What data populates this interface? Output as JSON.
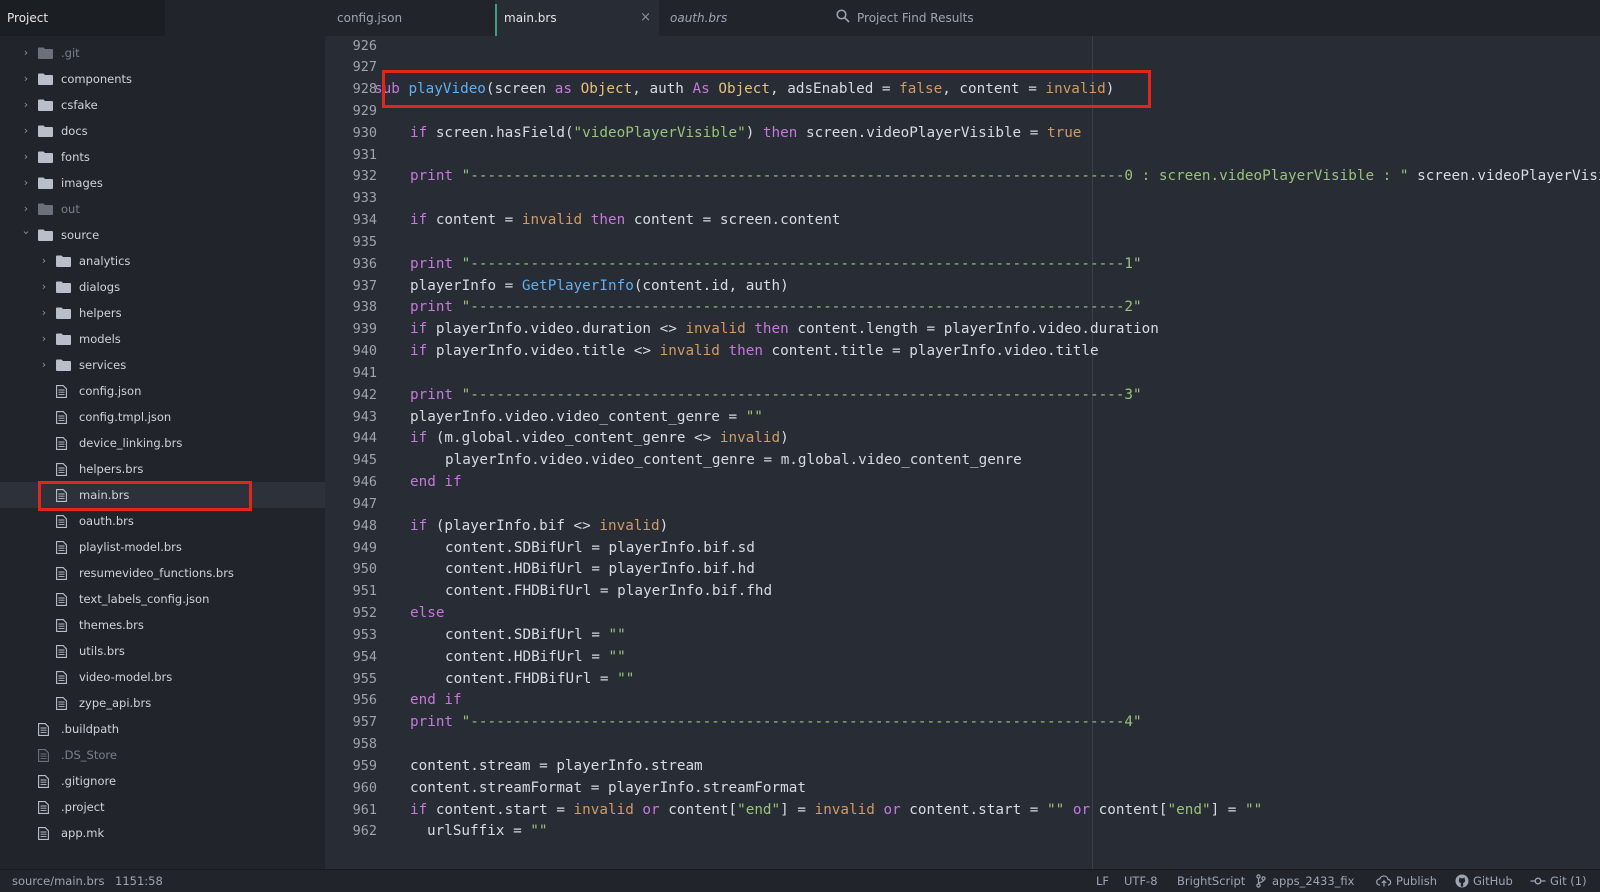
{
  "sidebar": {
    "title": "Project",
    "items": [
      {
        "label": ".git",
        "kind": "folder",
        "depth": 0,
        "expanded": false,
        "dim": true
      },
      {
        "label": "components",
        "kind": "folder",
        "depth": 0,
        "expanded": false
      },
      {
        "label": "csfake",
        "kind": "folder",
        "depth": 0,
        "expanded": false
      },
      {
        "label": "docs",
        "kind": "folder",
        "depth": 0,
        "expanded": false
      },
      {
        "label": "fonts",
        "kind": "folder",
        "depth": 0,
        "expanded": false
      },
      {
        "label": "images",
        "kind": "folder",
        "depth": 0,
        "expanded": false
      },
      {
        "label": "out",
        "kind": "folder",
        "depth": 0,
        "expanded": false,
        "dim": true
      },
      {
        "label": "source",
        "kind": "folder",
        "depth": 0,
        "expanded": true
      },
      {
        "label": "analytics",
        "kind": "folder",
        "depth": 1,
        "expanded": false
      },
      {
        "label": "dialogs",
        "kind": "folder",
        "depth": 1,
        "expanded": false
      },
      {
        "label": "helpers",
        "kind": "folder",
        "depth": 1,
        "expanded": false
      },
      {
        "label": "models",
        "kind": "folder",
        "depth": 1,
        "expanded": false
      },
      {
        "label": "services",
        "kind": "folder",
        "depth": 1,
        "expanded": false
      },
      {
        "label": "config.json",
        "kind": "file",
        "depth": 1
      },
      {
        "label": "config.tmpl.json",
        "kind": "file",
        "depth": 1
      },
      {
        "label": "device_linking.brs",
        "kind": "file",
        "depth": 1
      },
      {
        "label": "helpers.brs",
        "kind": "file",
        "depth": 1
      },
      {
        "label": "main.brs",
        "kind": "file",
        "depth": 1,
        "selected": true
      },
      {
        "label": "oauth.brs",
        "kind": "file",
        "depth": 1
      },
      {
        "label": "playlist-model.brs",
        "kind": "file",
        "depth": 1
      },
      {
        "label": "resumevideo_functions.brs",
        "kind": "file",
        "depth": 1
      },
      {
        "label": "text_labels_config.json",
        "kind": "file",
        "depth": 1
      },
      {
        "label": "themes.brs",
        "kind": "file",
        "depth": 1
      },
      {
        "label": "utils.brs",
        "kind": "file",
        "depth": 1
      },
      {
        "label": "video-model.brs",
        "kind": "file",
        "depth": 1
      },
      {
        "label": "zype_api.brs",
        "kind": "file",
        "depth": 1
      },
      {
        "label": ".buildpath",
        "kind": "file",
        "depth": 0
      },
      {
        "label": ".DS_Store",
        "kind": "file",
        "depth": 0,
        "dim": true
      },
      {
        "label": ".gitignore",
        "kind": "file",
        "depth": 0
      },
      {
        "label": ".project",
        "kind": "file",
        "depth": 0
      },
      {
        "label": "app.mk",
        "kind": "file",
        "depth": 0
      }
    ]
  },
  "tabs": [
    {
      "label": "config.json",
      "active": false,
      "italic": false
    },
    {
      "label": "main.brs",
      "active": true,
      "italic": false,
      "close": "×"
    },
    {
      "label": "oauth.brs",
      "active": false,
      "italic": true
    },
    {
      "label": "Project Find Results",
      "active": false,
      "italic": false,
      "icon": "search-icon"
    }
  ],
  "editor": {
    "lines": [
      {
        "n": "926",
        "indent": 0,
        "segments": []
      },
      {
        "n": "927",
        "indent": 0,
        "segments": []
      },
      {
        "n": "928",
        "indent": 0,
        "segments": [
          [
            "kw",
            "sub"
          ],
          [
            "p",
            " "
          ],
          [
            "fn",
            "playVideo"
          ],
          [
            "p",
            "(screen "
          ],
          [
            "kw",
            "as"
          ],
          [
            "p",
            " "
          ],
          [
            "kw2",
            "Object"
          ],
          [
            "p",
            ", auth "
          ],
          [
            "kw",
            "As"
          ],
          [
            "p",
            " "
          ],
          [
            "kw2",
            "Object"
          ],
          [
            "p",
            ", adsEnabled = "
          ],
          [
            "bool",
            "false"
          ],
          [
            "p",
            ", content = "
          ],
          [
            "bool",
            "invalid"
          ],
          [
            "p",
            ")"
          ]
        ]
      },
      {
        "n": "929",
        "indent": 0,
        "segments": []
      },
      {
        "n": "930",
        "indent": 1,
        "segments": [
          [
            "kw",
            "if"
          ],
          [
            "p",
            " screen.hasField("
          ],
          [
            "str",
            "\"videoPlayerVisible\""
          ],
          [
            "p",
            ") "
          ],
          [
            "kw",
            "then"
          ],
          [
            "p",
            " screen.videoPlayerVisible = "
          ],
          [
            "bool",
            "true"
          ]
        ]
      },
      {
        "n": "931",
        "indent": 0,
        "segments": []
      },
      {
        "n": "932",
        "indent": 1,
        "segments": [
          [
            "kw",
            "print"
          ],
          [
            "p",
            " "
          ],
          [
            "str",
            "\"----------------------------------------------------------------------------0 : screen.videoPlayerVisible : \""
          ],
          [
            "p",
            " screen.videoPlayerVisible"
          ]
        ]
      },
      {
        "n": "933",
        "indent": 0,
        "segments": []
      },
      {
        "n": "934",
        "indent": 1,
        "segments": [
          [
            "kw",
            "if"
          ],
          [
            "p",
            " content = "
          ],
          [
            "bool",
            "invalid"
          ],
          [
            "p",
            " "
          ],
          [
            "kw",
            "then"
          ],
          [
            "p",
            " content = screen.content"
          ]
        ]
      },
      {
        "n": "935",
        "indent": 0,
        "segments": []
      },
      {
        "n": "936",
        "indent": 1,
        "segments": [
          [
            "kw",
            "print"
          ],
          [
            "p",
            " "
          ],
          [
            "str",
            "\"----------------------------------------------------------------------------1\""
          ]
        ]
      },
      {
        "n": "937",
        "indent": 1,
        "segments": [
          [
            "p",
            "playerInfo = "
          ],
          [
            "fn",
            "GetPlayerInfo"
          ],
          [
            "p",
            "(content.id, auth)"
          ]
        ]
      },
      {
        "n": "938",
        "indent": 1,
        "segments": [
          [
            "kw",
            "print"
          ],
          [
            "p",
            " "
          ],
          [
            "str",
            "\"----------------------------------------------------------------------------2\""
          ]
        ]
      },
      {
        "n": "939",
        "indent": 1,
        "segments": [
          [
            "kw",
            "if"
          ],
          [
            "p",
            " playerInfo.video.duration <> "
          ],
          [
            "bool",
            "invalid"
          ],
          [
            "p",
            " "
          ],
          [
            "kw",
            "then"
          ],
          [
            "p",
            " content.length = playerInfo.video.duration"
          ]
        ]
      },
      {
        "n": "940",
        "indent": 1,
        "segments": [
          [
            "kw",
            "if"
          ],
          [
            "p",
            " playerInfo.video.title <> "
          ],
          [
            "bool",
            "invalid"
          ],
          [
            "p",
            " "
          ],
          [
            "kw",
            "then"
          ],
          [
            "p",
            " content.title = playerInfo.video.title"
          ]
        ]
      },
      {
        "n": "941",
        "indent": 0,
        "segments": []
      },
      {
        "n": "942",
        "indent": 1,
        "segments": [
          [
            "kw",
            "print"
          ],
          [
            "p",
            " "
          ],
          [
            "str",
            "\"----------------------------------------------------------------------------3\""
          ]
        ]
      },
      {
        "n": "943",
        "indent": 1,
        "segments": [
          [
            "p",
            "playerInfo.video.video_content_genre = "
          ],
          [
            "str",
            "\"\""
          ]
        ]
      },
      {
        "n": "944",
        "indent": 1,
        "segments": [
          [
            "kw",
            "if"
          ],
          [
            "p",
            " (m.global.video_content_genre <> "
          ],
          [
            "bool",
            "invalid"
          ],
          [
            "p",
            ")"
          ]
        ]
      },
      {
        "n": "945",
        "indent": 2,
        "segments": [
          [
            "p",
            "playerInfo.video.video_content_genre = m.global.video_content_genre"
          ]
        ]
      },
      {
        "n": "946",
        "indent": 1,
        "segments": [
          [
            "kw",
            "end if"
          ]
        ]
      },
      {
        "n": "947",
        "indent": 0,
        "segments": []
      },
      {
        "n": "948",
        "indent": 1,
        "segments": [
          [
            "kw",
            "if"
          ],
          [
            "p",
            " (playerInfo.bif <> "
          ],
          [
            "bool",
            "invalid"
          ],
          [
            "p",
            ")"
          ]
        ]
      },
      {
        "n": "949",
        "indent": 2,
        "segments": [
          [
            "p",
            "content.SDBifUrl = playerInfo.bif.sd"
          ]
        ]
      },
      {
        "n": "950",
        "indent": 2,
        "segments": [
          [
            "p",
            "content.HDBifUrl = playerInfo.bif.hd"
          ]
        ]
      },
      {
        "n": "951",
        "indent": 2,
        "segments": [
          [
            "p",
            "content.FHDBifUrl = playerInfo.bif.fhd"
          ]
        ]
      },
      {
        "n": "952",
        "indent": 1,
        "segments": [
          [
            "kw",
            "else"
          ]
        ]
      },
      {
        "n": "953",
        "indent": 2,
        "segments": [
          [
            "p",
            "content.SDBifUrl = "
          ],
          [
            "str",
            "\"\""
          ]
        ]
      },
      {
        "n": "954",
        "indent": 2,
        "segments": [
          [
            "p",
            "content.HDBifUrl = "
          ],
          [
            "str",
            "\"\""
          ]
        ]
      },
      {
        "n": "955",
        "indent": 2,
        "segments": [
          [
            "p",
            "content.FHDBifUrl = "
          ],
          [
            "str",
            "\"\""
          ]
        ]
      },
      {
        "n": "956",
        "indent": 1,
        "segments": [
          [
            "kw",
            "end if"
          ]
        ]
      },
      {
        "n": "957",
        "indent": 1,
        "segments": [
          [
            "kw",
            "print"
          ],
          [
            "p",
            " "
          ],
          [
            "str",
            "\"----------------------------------------------------------------------------4\""
          ]
        ]
      },
      {
        "n": "958",
        "indent": 0,
        "segments": []
      },
      {
        "n": "959",
        "indent": 1,
        "segments": [
          [
            "p",
            "content.stream = playerInfo.stream"
          ]
        ]
      },
      {
        "n": "960",
        "indent": 1,
        "segments": [
          [
            "p",
            "content.streamFormat = playerInfo.streamFormat"
          ]
        ]
      },
      {
        "n": "961",
        "indent": 1,
        "segments": [
          [
            "kw",
            "if"
          ],
          [
            "p",
            " content.start = "
          ],
          [
            "bool",
            "invalid"
          ],
          [
            "p",
            " "
          ],
          [
            "kw",
            "or"
          ],
          [
            "p",
            " content["
          ],
          [
            "str",
            "\"end\""
          ],
          [
            "p",
            "] = "
          ],
          [
            "bool",
            "invalid"
          ],
          [
            "p",
            " "
          ],
          [
            "kw",
            "or"
          ],
          [
            "p",
            " content.start = "
          ],
          [
            "str",
            "\"\""
          ],
          [
            "p",
            " "
          ],
          [
            "kw",
            "or"
          ],
          [
            "p",
            " content["
          ],
          [
            "str",
            "\"end\""
          ],
          [
            "p",
            "] = "
          ],
          [
            "str",
            "\"\""
          ]
        ]
      },
      {
        "n": "962",
        "indent": 1.5,
        "segments": [
          [
            "p",
            "urlSuffix = "
          ],
          [
            "str",
            "\"\""
          ]
        ]
      }
    ]
  },
  "statusbar": {
    "file_path": "source/main.brs",
    "cursor": "1151:58",
    "line_ending": "LF",
    "encoding": "UTF-8",
    "grammar": "BrightScript",
    "branch": "apps_2433_fix",
    "publish": "Publish",
    "github": "GitHub",
    "git": "Git (1)"
  },
  "colors": {
    "accent_tab": "#3fa07a",
    "highlight": "#e3261b",
    "keyword": "#c678dd",
    "type": "#e5c07b",
    "string": "#98c379",
    "constant": "#d19a66"
  }
}
